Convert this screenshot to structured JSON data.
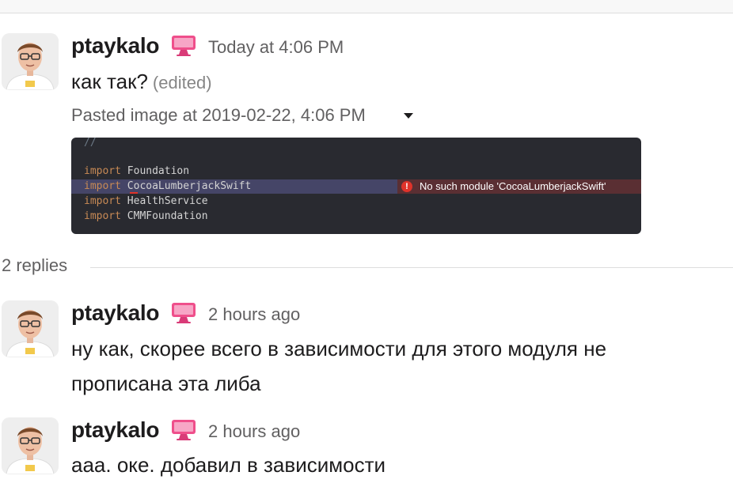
{
  "messages": [
    {
      "username": "ptaykalo",
      "time": "Today at 4:06 PM",
      "text": "как так?",
      "edited": "(edited)",
      "attachment": {
        "title": "Pasted image at 2019-02-22, 4:06 PM",
        "code_comment": "//",
        "code_lines": [
          {
            "keyword": "import",
            "module": "Foundation"
          },
          {
            "keyword": "import",
            "module": "CocoaLumberjackSwift"
          },
          {
            "keyword": "import",
            "module": "HealthService"
          },
          {
            "keyword": "import",
            "module": "CMMFoundation"
          }
        ],
        "error_icon": "!",
        "error_message": "No such module 'CocoaLumberjackSwift'"
      }
    }
  ],
  "thread": {
    "replies_label": "2 replies",
    "replies": [
      {
        "username": "ptaykalo",
        "time": "2 hours ago",
        "text_lines": [
          "ну как, скорее всего в зависимости  для этого модуля не",
          "прописана эта либа"
        ]
      },
      {
        "username": "ptaykalo",
        "time": "2 hours ago",
        "text_lines": [
          "ааа. оке. добавил в зависимости"
        ]
      }
    ]
  },
  "icons": {
    "avatar": "user-avatar",
    "status_emoji": "pink-imac-icon",
    "attachment_menu": "caret-down-icon",
    "error": "error-badge-icon"
  },
  "colors": {
    "text": "#1d1c1d",
    "muted": "#616061",
    "edited": "#868686",
    "code_bg": "#292a30",
    "code_keyword": "#c88a55",
    "error_red": "#e0332a",
    "badge_pink": "#ef4f8b"
  }
}
